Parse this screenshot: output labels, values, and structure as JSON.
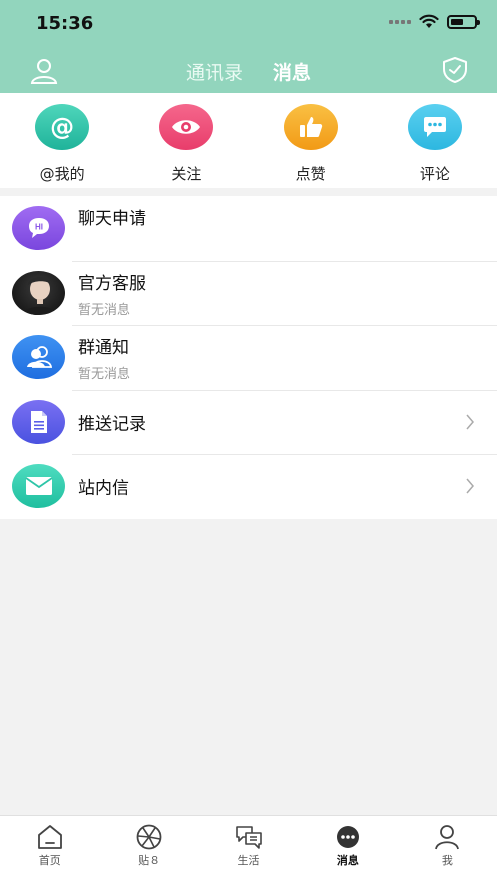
{
  "status": {
    "time": "15:36"
  },
  "header": {
    "tabs": [
      {
        "label": "通讯录",
        "active": false
      },
      {
        "label": "消息",
        "active": true
      }
    ]
  },
  "quick_actions": [
    {
      "label": "@我的",
      "icon": "at-icon",
      "color": "#2ec5a8"
    },
    {
      "label": "关注",
      "icon": "eye-icon",
      "color": "#f0507a"
    },
    {
      "label": "点赞",
      "icon": "thumbs-up-icon",
      "color": "#f6b02a"
    },
    {
      "label": "评论",
      "icon": "comment-icon",
      "color": "#40c4e8"
    }
  ],
  "messages": [
    {
      "title": "聊天申请",
      "subtitle": "",
      "icon": "chat-hi-icon",
      "color": "#8a55e8"
    },
    {
      "title": "官方客服",
      "subtitle": "暂无消息",
      "icon": "support-avatar",
      "color": "#222222"
    },
    {
      "title": "群通知",
      "subtitle": "暂无消息",
      "icon": "group-icon",
      "color": "#2f7fe8"
    },
    {
      "title": "推送记录",
      "subtitle": "",
      "icon": "document-icon",
      "color": "#5a5ee8"
    },
    {
      "title": "站内信",
      "subtitle": "",
      "icon": "mail-icon",
      "color": "#2ec5a8"
    }
  ],
  "tabbar": [
    {
      "label": "首页",
      "icon": "home-icon",
      "active": false
    },
    {
      "label": "贴８",
      "icon": "aperture-icon",
      "active": false
    },
    {
      "label": "生活",
      "icon": "chat-bubbles-icon",
      "active": false
    },
    {
      "label": "消息",
      "icon": "message-icon",
      "active": true
    },
    {
      "label": "我",
      "icon": "person-icon",
      "active": false
    }
  ],
  "colors": {
    "header": "#92d5bd",
    "background": "#f2f2f2"
  }
}
